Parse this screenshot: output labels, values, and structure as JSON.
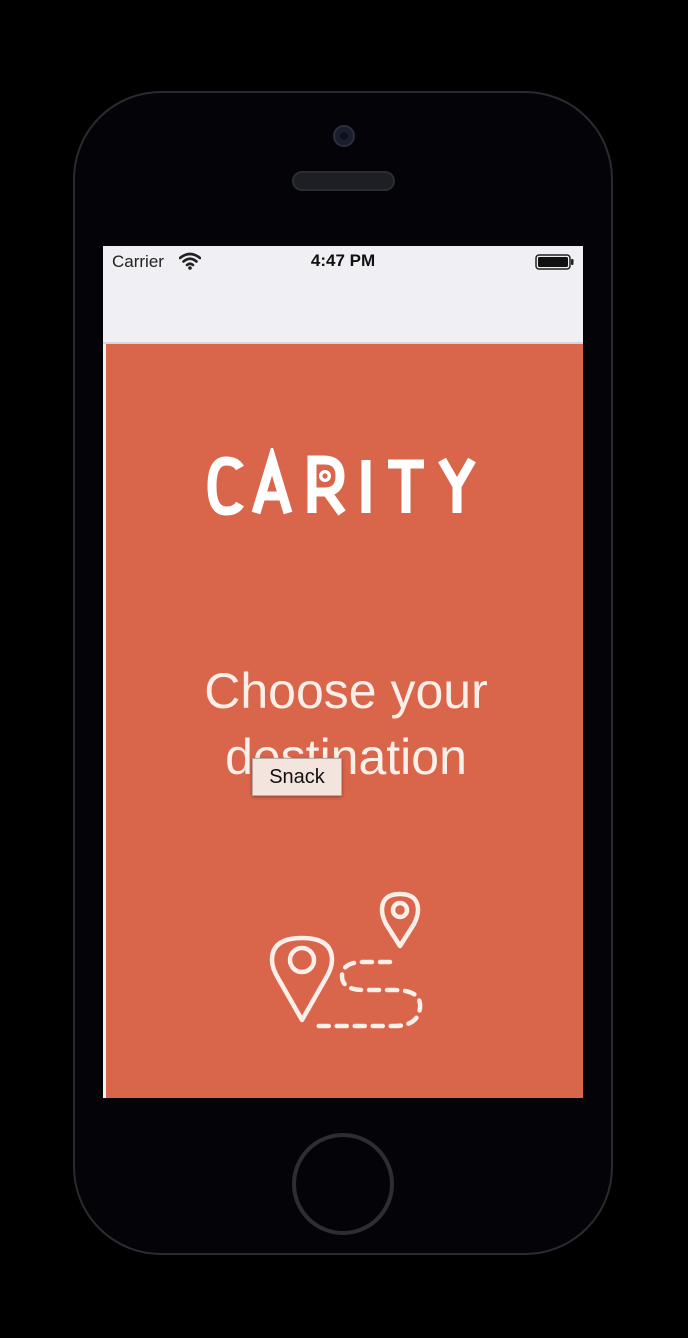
{
  "status_bar": {
    "carrier": "Carrier",
    "time": "4:47 PM",
    "wifi_icon": "wifi-icon",
    "battery_icon": "battery-full-icon"
  },
  "splash": {
    "logo_text": "CARITY",
    "headline": "Choose your destination",
    "illustration_icon": "map-route-pins-icon"
  },
  "tooltip": {
    "label": "Snack"
  },
  "colors": {
    "brand": "#d9654b",
    "on_brand_text": "#fbefea",
    "nav_bar": "#efeff4",
    "device_frame": "#040408"
  }
}
